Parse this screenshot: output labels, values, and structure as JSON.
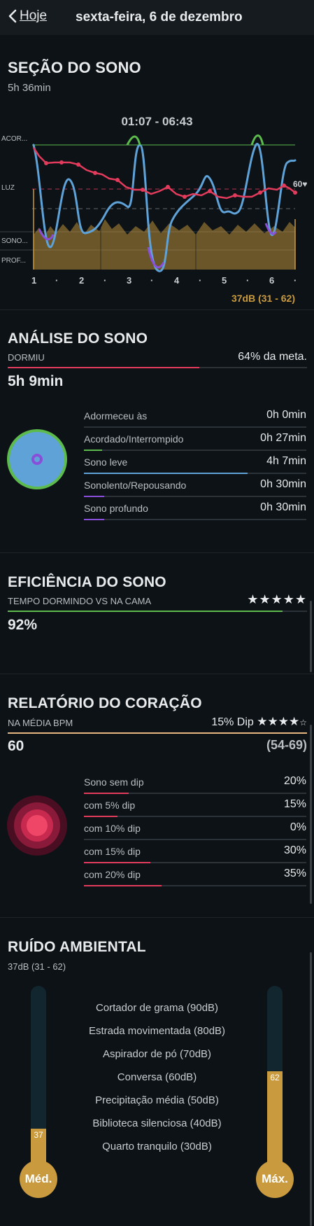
{
  "header": {
    "back_label": "Hoje",
    "date": "sexta-feira, 6 de dezembro"
  },
  "session": {
    "title": "SEÇÃO DO SONO",
    "duration": "5h 36min",
    "time_range": "01:07 - 06:43",
    "y_labels": [
      "ACOR...",
      "LUZ",
      "SONO...",
      "PROF..."
    ],
    "x_ticks": [
      "1",
      "·",
      "2",
      "·",
      "3",
      "·",
      "4",
      "·",
      "5",
      "·",
      "6",
      "·"
    ],
    "hr_label": "60♥",
    "noise_label": "37dB (31 - 62)"
  },
  "analysis": {
    "title": "ANÁLISE DO SONO",
    "label": "DORMIU",
    "goal": "64% da meta.",
    "goal_fraction": 0.64,
    "value": "5h 9min",
    "rows": [
      {
        "label": "Adormeceu às",
        "value": "0h 0min",
        "fraction": 0,
        "color": "#6ea8dc"
      },
      {
        "label": "Acordado/Interrompido",
        "value": "0h 27min",
        "fraction": 0.08,
        "color": "#5dbb4e"
      },
      {
        "label": "Sono leve",
        "value": "4h 7min",
        "fraction": 0.66,
        "color": "#5fa2d8"
      },
      {
        "label": "Sonolento/Repousando",
        "value": "0h 30min",
        "fraction": 0.09,
        "color": "#8a4fd8"
      },
      {
        "label": "Sono profundo",
        "value": "0h 30min",
        "fraction": 0.09,
        "color": "#8a4fd8"
      }
    ]
  },
  "efficiency": {
    "title": "EFICIÊNCIA DO SONO",
    "label": "TEMPO DORMINDO VS NA CAMA",
    "stars": "★★★★★",
    "value": "92%",
    "fraction": 0.92
  },
  "heart": {
    "title": "RELATÓRIO DO CORAÇÃO",
    "label": "NA MÉDIA BPM",
    "dip": "15% Dip",
    "stars_full": "★★★★",
    "stars_half": "☆",
    "value": "60",
    "range": "(54-69)",
    "rows": [
      {
        "label": "Sono sem dip",
        "value": "20%",
        "fraction": 0.2
      },
      {
        "label": "com 5% dip",
        "value": "15%",
        "fraction": 0.15
      },
      {
        "label": "com 10% dip",
        "value": "0%",
        "fraction": 0.0
      },
      {
        "label": "com 15% dip",
        "value": "30%",
        "fraction": 0.3
      },
      {
        "label": "com 20% dip",
        "value": "35%",
        "fraction": 0.35
      }
    ]
  },
  "noise": {
    "title": "RUÍDO AMBIENTAL",
    "subtitle": "37dB (31 - 62)",
    "items": [
      "Cortador de grama (90dB)",
      "Estrada movimentada (80dB)",
      "Aspirador de pó (70dB)",
      "Conversa (60dB)",
      "Precipitação média (50dB)",
      "Biblioteca silenciosa (40dB)",
      "Quarto tranquilo (30dB)"
    ],
    "avg_value": "37",
    "max_value": "62",
    "avg_label": "Méd.",
    "max_label": "Máx."
  },
  "colors": {
    "accent_gold": "#c99a3e",
    "heart_red": "#e33b5c",
    "light_blue": "#5fa2d8",
    "awake_green": "#5dbb4e",
    "deep_purple": "#8a4fd8"
  }
}
